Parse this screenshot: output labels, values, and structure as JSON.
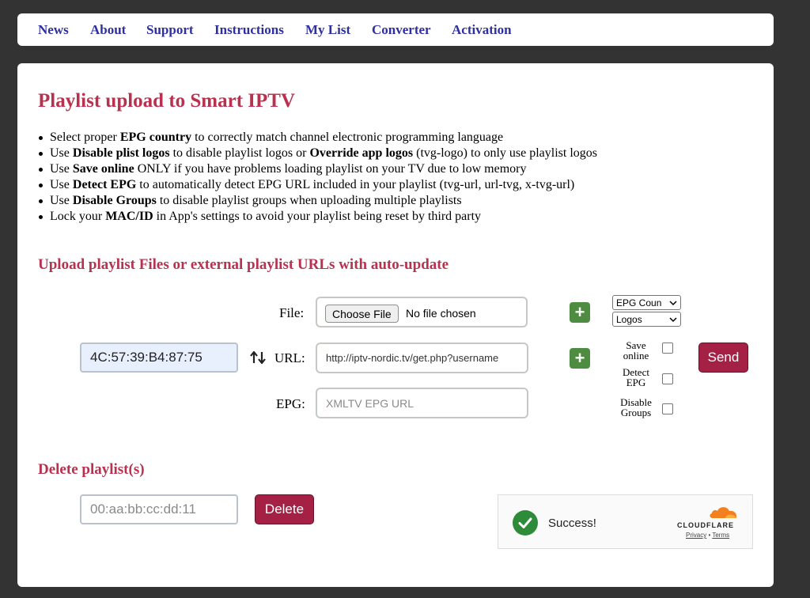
{
  "nav": {
    "items": [
      "News",
      "About",
      "Support",
      "Instructions",
      "My List",
      "Converter",
      "Activation"
    ]
  },
  "page": {
    "title": "Playlist upload to Smart IPTV"
  },
  "bullets": [
    {
      "pre": "Select proper ",
      "b1": "EPG country",
      "mid": " to correctly match channel electronic programming language",
      "b2": "",
      "post": ""
    },
    {
      "pre": "Use ",
      "b1": "Disable plist logos",
      "mid": " to disable playlist logos or ",
      "b2": "Override app logos",
      "post": " (tvg-logo) to only use playlist logos"
    },
    {
      "pre": "Use ",
      "b1": "Save online",
      "mid": " ONLY if you have problems loading playlist on your TV due to low memory",
      "b2": "",
      "post": ""
    },
    {
      "pre": "Use ",
      "b1": "Detect EPG",
      "mid": " to automatically detect EPG URL included in your playlist (tvg-url, url-tvg, x-tvg-url)",
      "b2": "",
      "post": ""
    },
    {
      "pre": "Use ",
      "b1": "Disable Groups",
      "mid": " to disable playlist groups when uploading multiple playlists",
      "b2": "",
      "post": ""
    },
    {
      "pre": "Lock your ",
      "b1": "MAC/ID",
      "mid": " in App's settings to avoid your playlist being reset by third party",
      "b2": "",
      "post": ""
    }
  ],
  "upload": {
    "heading": "Upload playlist Files or external playlist URLs with auto-update",
    "file_label": "File:",
    "choose_file": "Choose File",
    "no_file": "No file chosen",
    "url_label": "URL:",
    "url_value": "http://iptv-nordic.tv/get.php?username",
    "epg_label": "EPG:",
    "epg_placeholder": "XMLTV EPG URL",
    "mac_value": "4C:57:39:B4:87:75",
    "swap_icon": "swap-vertical-icon",
    "plus": "+",
    "epg_country_select": "EPG Coun",
    "logos_select": "Logos",
    "save_online": "Save online",
    "detect_epg": "Detect EPG",
    "disable_groups": "Disable Groups",
    "send": "Send"
  },
  "delete": {
    "heading": "Delete playlist(s)",
    "mac_placeholder": "00:aa:bb:cc:dd:11",
    "button": "Delete"
  },
  "captcha": {
    "status": "Success!",
    "brand": "CLOUDFLARE",
    "privacy": "Privacy",
    "separator": "•",
    "terms": "Terms"
  },
  "colors": {
    "accent": "#b8314f",
    "nav_link": "#2e2fa0",
    "button_red": "#a52045",
    "plus_green": "#4e8c41",
    "success_green": "#2e8b3a"
  }
}
